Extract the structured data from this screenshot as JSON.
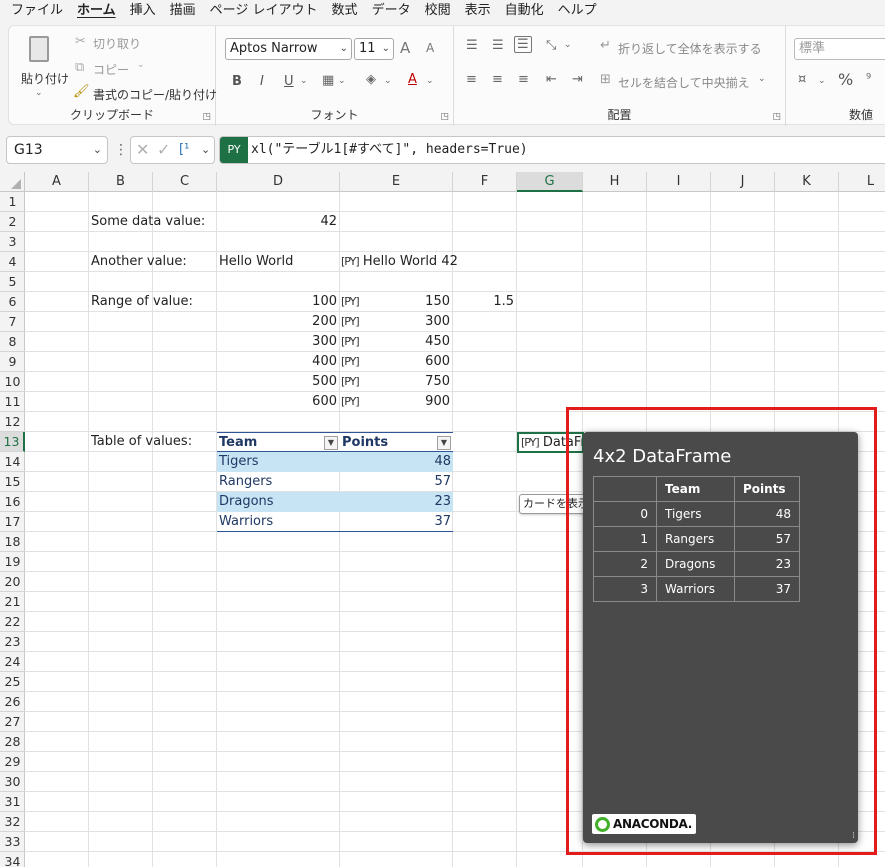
{
  "menu": [
    "ファイル",
    "ホーム",
    "挿入",
    "描画",
    "ページ レイアウト",
    "数式",
    "データ",
    "校閲",
    "表示",
    "自動化",
    "ヘルプ"
  ],
  "active_menu": "ホーム",
  "ribbon": {
    "clipboard": {
      "label": "クリップボード",
      "paste": "貼り付け",
      "cut": "切り取り",
      "copy": "コピー",
      "format_painter": "書式のコピー/貼り付け"
    },
    "font": {
      "label": "フォント",
      "font_name": "Aptos Narrow",
      "font_size": "11",
      "grow": "A",
      "shrink": "A",
      "bold": "B",
      "italic": "I",
      "underline": "U"
    },
    "alignment": {
      "label": "配置",
      "wrap_text": "折り返して全体を表示する",
      "merge_center": "セルを結合して中央揃え"
    },
    "number": {
      "label": "数値",
      "format": "標準",
      "percent": "%"
    }
  },
  "formula_bar": {
    "name_box": "G13",
    "py_badge": "PY",
    "formula": "xl(\"テーブル1[#すべて]\", headers=True)"
  },
  "columns": [
    "A",
    "B",
    "C",
    "D",
    "E",
    "F",
    "G",
    "H",
    "I",
    "J",
    "K",
    "L"
  ],
  "selected_column": "G",
  "rows": [
    "1",
    "2",
    "3",
    "4",
    "5",
    "6",
    "7",
    "8",
    "9",
    "10",
    "11",
    "12",
    "13",
    "14",
    "15",
    "16",
    "17",
    "18",
    "19",
    "20",
    "21",
    "22",
    "23",
    "24",
    "25",
    "26",
    "27",
    "28",
    "29",
    "30",
    "31",
    "32",
    "33",
    "34"
  ],
  "selected_row": "13",
  "sheet": {
    "b2": "Some data value:",
    "d2": "42",
    "b4": "Another value:",
    "d4": "Hello World",
    "e4": "Hello World 42",
    "b6": "Range of value:",
    "range_d": [
      "100",
      "200",
      "300",
      "400",
      "500",
      "600"
    ],
    "range_e": [
      "150",
      "300",
      "450",
      "600",
      "750",
      "900"
    ],
    "f6": "1.5",
    "b13": "Table of values:",
    "py_icon": "[PY]",
    "table_headers": [
      "Team",
      "Points"
    ],
    "table_rows": [
      [
        "Tigers",
        "48"
      ],
      [
        "Rangers",
        "57"
      ],
      [
        "Dragons",
        "23"
      ],
      [
        "Warriors",
        "37"
      ]
    ],
    "g13": "DataFrame",
    "tooltip": "カードを表示"
  },
  "df_card": {
    "title": "4x2 DataFrame",
    "headers": [
      "",
      "Team",
      "Points"
    ],
    "rows": [
      [
        "0",
        "Tigers",
        "48"
      ],
      [
        "1",
        "Rangers",
        "57"
      ],
      [
        "2",
        "Dragons",
        "23"
      ],
      [
        "3",
        "Warriors",
        "37"
      ]
    ],
    "logo": "ANACONDA."
  },
  "colors": {
    "accent": "#1e7145",
    "highlight": "#e21b1b",
    "card_bg": "#4a4a4a",
    "table_band": "#c6e4f4"
  }
}
